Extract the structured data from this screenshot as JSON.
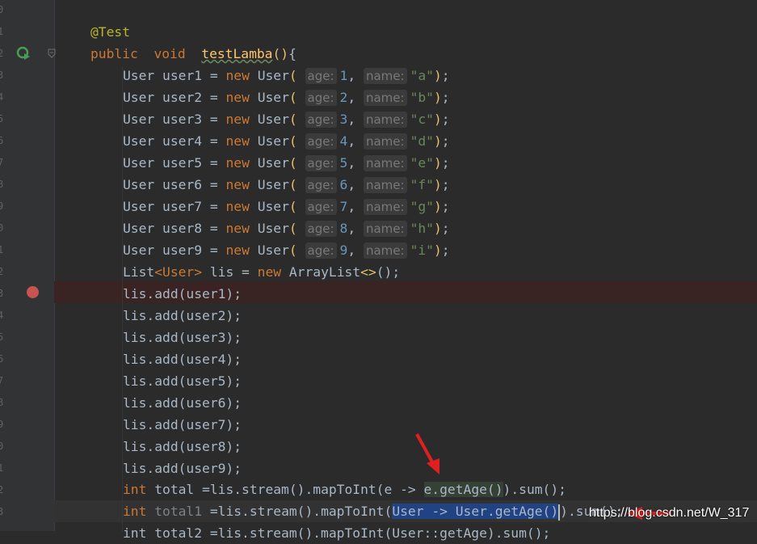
{
  "line_numbers": [
    "0",
    "1",
    "2",
    "3",
    "4",
    "5",
    "6",
    "7",
    "8",
    "9",
    "0",
    "1",
    "2",
    "3",
    "4",
    "5",
    "6",
    "7",
    "8",
    "9",
    "0",
    "1",
    "2",
    "3"
  ],
  "code": {
    "annotation": "@Test",
    "method_decl": {
      "kw1": "public",
      "kw2": "void",
      "name": "testLamba",
      "parens": "()",
      "brace": "{"
    },
    "users": [
      {
        "var": "user1",
        "age": "1",
        "name": "\"a\""
      },
      {
        "var": "user2",
        "age": "2",
        "name": "\"b\""
      },
      {
        "var": "user3",
        "age": "3",
        "name": "\"c\""
      },
      {
        "var": "user4",
        "age": "4",
        "name": "\"d\""
      },
      {
        "var": "user5",
        "age": "5",
        "name": "\"e\""
      },
      {
        "var": "user6",
        "age": "6",
        "name": "\"f\""
      },
      {
        "var": "user7",
        "age": "7",
        "name": "\"g\""
      },
      {
        "var": "user8",
        "age": "8",
        "name": "\"h\""
      },
      {
        "var": "user9",
        "age": "9",
        "name": "\"i\""
      }
    ],
    "user_type": "User",
    "new_kw": "new",
    "age_hint": "age:",
    "name_hint": "name:",
    "list_line": {
      "type": "List",
      "generic": "<User>",
      "rest": " lis = ",
      "new": "new",
      "cls": " ArrayList",
      "diamond": "<>",
      "end": "();"
    },
    "adds": [
      "lis.add(user1);",
      "lis.add(user2);",
      "lis.add(user3);",
      "lis.add(user4);",
      "lis.add(user5);",
      "lis.add(user6);",
      "lis.add(user7);",
      "lis.add(user8);",
      "lis.add(user9);"
    ],
    "total_line": {
      "kw": "int",
      "pre": " total =lis.stream().mapToInt(e -> ",
      "hl": "e.getAge()",
      "post": ").sum();"
    },
    "total1_line": {
      "kw": "int",
      "var": " total1",
      "pre": " =lis.stream().mapToInt(",
      "sel": "User -> User.getAge()",
      "post": ").sum();"
    },
    "partial_line": "int total2 =lis.stream().mapToInt(User::getAge).sum();"
  },
  "watermark": "https://blog.csdn.net/W_317",
  "icons": {
    "run": "run-test-icon",
    "breakpoint": "breakpoint-icon",
    "fold": "fold-icon",
    "arrow": "red-arrow-icon"
  },
  "colors": {
    "background": "#2b2b2b",
    "keyword": "#cc7832",
    "string": "#6a8759",
    "number": "#6897bb",
    "method": "#ffc66d",
    "breakpoint": "#c75450",
    "selection": "#214283"
  }
}
